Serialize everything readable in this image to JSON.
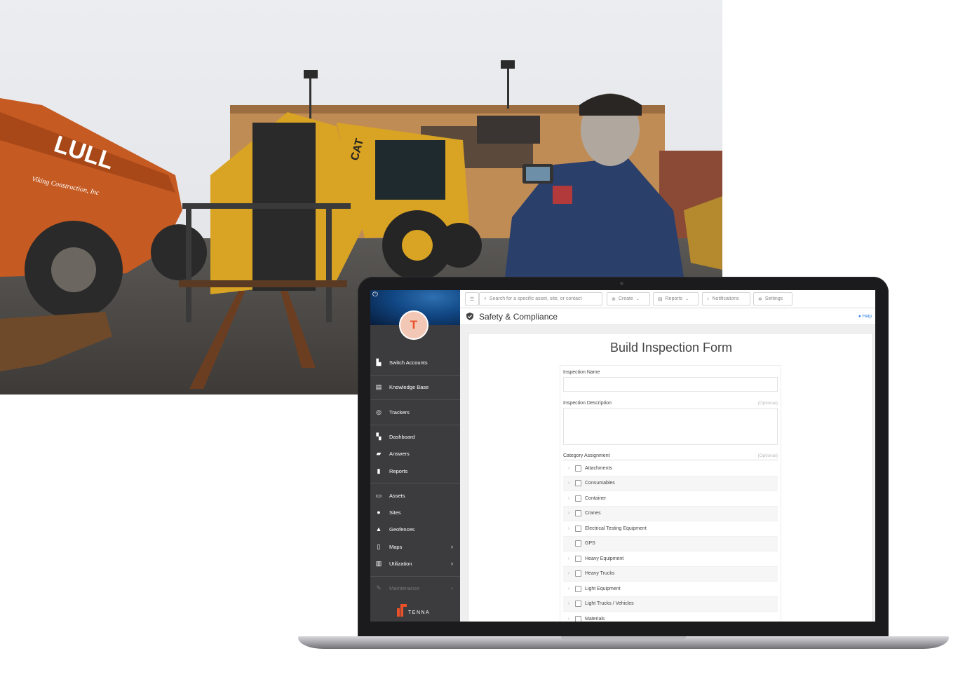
{
  "photo": {
    "alt": "",
    "machine_brand": "LULL",
    "company_decal": "Viking Construction, Inc",
    "cat_decal": "CAT"
  },
  "app": {
    "brand": "TENNA",
    "avatar_initial": "T",
    "colors": {
      "accent": "#e8502a",
      "sidebar": "#3c3c3e",
      "link": "#2c7be5"
    }
  },
  "sidebar": {
    "items": [
      {
        "label": "Switch Accounts",
        "icon": "building-icon"
      },
      {
        "label": "Knowledge Base",
        "icon": "book-icon"
      },
      {
        "label": "Trackers",
        "icon": "tracker-icon"
      },
      {
        "label": "Dashboard",
        "icon": "dashboard-icon"
      },
      {
        "label": "Answers",
        "icon": "chat-icon"
      },
      {
        "label": "Reports",
        "icon": "file-icon"
      },
      {
        "label": "Assets",
        "icon": "list-icon"
      },
      {
        "label": "Sites",
        "icon": "pin-icon"
      },
      {
        "label": "Geofences",
        "icon": "shapes-icon"
      },
      {
        "label": "Maps",
        "icon": "map-icon"
      },
      {
        "label": "Utilization",
        "icon": "chart-icon"
      },
      {
        "label": "Maintenance",
        "icon": "wrench-icon"
      }
    ]
  },
  "topbar": {
    "search_placeholder": "Search for a specific asset, site, or contact",
    "create_label": "Create",
    "reports_label": "Reports",
    "notifications_label": "Notifications",
    "settings_label": "Settings"
  },
  "page": {
    "title": "Safety & Compliance",
    "help_label": "Help"
  },
  "form": {
    "title": "Build Inspection Form",
    "name_label": "Inspection Name",
    "description_label": "Inspection Description",
    "description_optional": "(Optional)",
    "category_label": "Category Assignment",
    "category_optional": "(Optional)",
    "categories": [
      "Attachments",
      "Consumables",
      "Container",
      "Cranes",
      "Electrical Testing Equipment",
      "GPS",
      "Heavy Equipment",
      "Heavy Trucks",
      "Light Equipment",
      "Light Trucks / Vehicles",
      "Materials"
    ]
  }
}
